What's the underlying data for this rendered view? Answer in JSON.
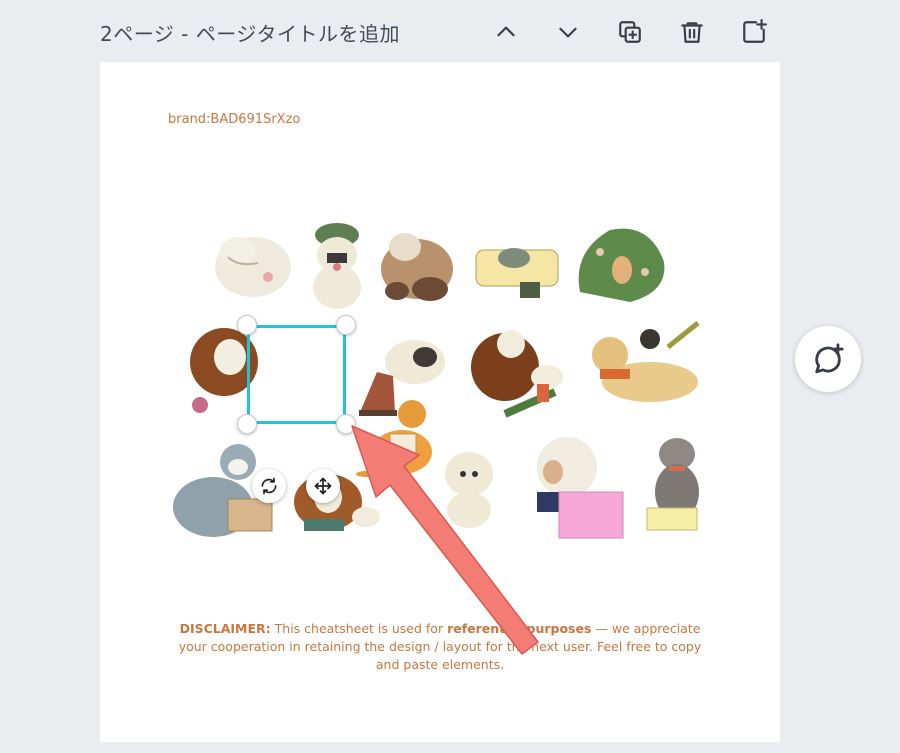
{
  "header": {
    "page_title": "2ページ - ページタイトルを追加",
    "icons": [
      "chevron-up-icon",
      "chevron-down-icon",
      "duplicate-page-icon",
      "trash-icon",
      "add-page-icon"
    ]
  },
  "canvas": {
    "brand_text": "brand:BAD691SrXzo",
    "disclaimer": {
      "label": "DISCLAIMER:",
      "text1": " This cheatsheet is used for ",
      "bold": "referential purposes",
      "text2": " — we appreciate your cooperation in retaining the design / layout for the next user. Feel free to copy and paste elements."
    }
  },
  "tools": {
    "rotate_icon": "rotate-icon",
    "move_icon": "move-icon",
    "comment_icon": "add-comment-icon"
  },
  "colors": {
    "selection": "#21c4d8",
    "accent_text": "#c9773e",
    "arrow": "#f37d74"
  }
}
